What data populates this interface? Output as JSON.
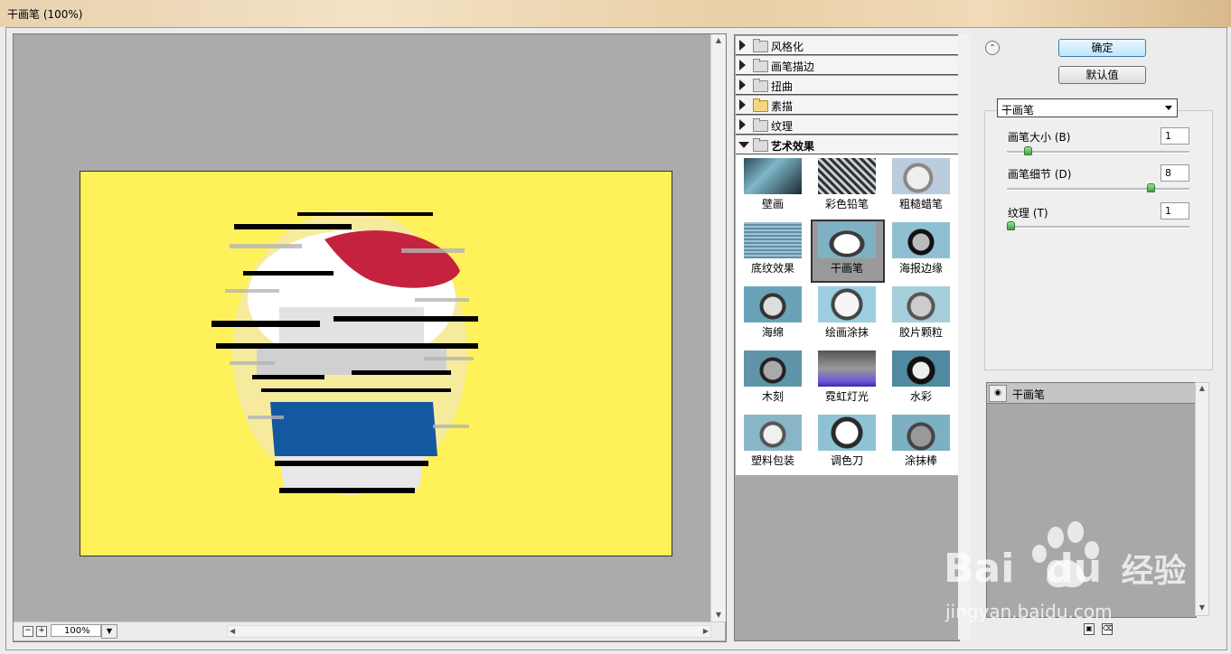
{
  "window": {
    "title": "干画笔 (100%)"
  },
  "preview": {
    "zoom_minus": "−",
    "zoom_plus": "+",
    "zoom_value": "100%"
  },
  "gallery": {
    "categories": [
      {
        "label": "风格化",
        "open": false
      },
      {
        "label": "画笔描边",
        "open": false
      },
      {
        "label": "扭曲",
        "open": false
      },
      {
        "label": "素描",
        "open": false
      },
      {
        "label": "纹理",
        "open": false
      },
      {
        "label": "艺术效果",
        "open": true
      }
    ],
    "thumbnails": [
      "壁画",
      "彩色铅笔",
      "粗糙蜡笔",
      "底纹效果",
      "干画笔",
      "海报边缘",
      "海绵",
      "绘画涂抹",
      "胶片颗粒",
      "木刻",
      "霓虹灯光",
      "水彩",
      "塑料包装",
      "调色刀",
      "涂抹棒"
    ],
    "selected": "干画笔"
  },
  "buttons": {
    "ok": "确定",
    "default": "默认值"
  },
  "filter_select": {
    "value": "干画笔"
  },
  "params": [
    {
      "label": "画笔大小 (B)",
      "value": "1",
      "level": 0.1
    },
    {
      "label": "画笔细节 (D)",
      "value": "8",
      "level": 0.8
    },
    {
      "label": "纹理 (T)",
      "value": "1",
      "level": 0.0
    }
  ],
  "layers": {
    "items": [
      {
        "name": "干画笔"
      }
    ]
  },
  "watermark": {
    "brand": "Bai",
    "brand2": "du",
    "suffix": "经验",
    "url": "jingyan.baidu.com"
  },
  "colors": {
    "canvas": "#fef15a",
    "preview_bg": "#ababab",
    "ok_button": "#bee6fd",
    "slider_knob": "#3da33d"
  }
}
